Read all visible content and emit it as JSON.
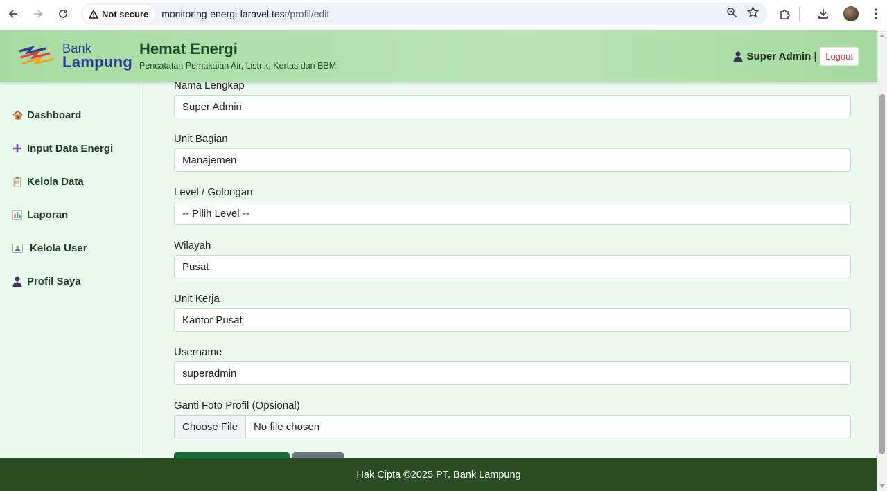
{
  "browser": {
    "security_label": "Not secure",
    "url_host": "monitoring-energi-laravel.test",
    "url_path": "/profil/edit"
  },
  "header": {
    "logo_bank": "Bank",
    "logo_lampung": "Lampung",
    "title": "Hemat Energi",
    "subtitle": "Pencatatan Pemakaian Air, Listrik, Kertas dan BBM",
    "user_name": "Super Admin",
    "separator": "|",
    "logout_label": "Logout"
  },
  "sidebar": {
    "items": [
      {
        "label": "Dashboard",
        "icon": "house-icon"
      },
      {
        "label": "Input Data Energi",
        "icon": "plus-icon"
      },
      {
        "label": "Kelola Data",
        "icon": "clipboard-icon"
      },
      {
        "label": "Laporan",
        "icon": "bar-chart-icon"
      },
      {
        "label": "Kelola User",
        "icon": "id-card-icon"
      },
      {
        "label": "Profil Saya",
        "icon": "user-icon"
      }
    ]
  },
  "form": {
    "nama_label": "Nama Lengkap",
    "nama_value": "Super Admin",
    "unit_bagian_label": "Unit Bagian",
    "unit_bagian_value": "Manajemen",
    "level_label": "Level / Golongan",
    "level_value": "-- Pilih Level --",
    "wilayah_label": "Wilayah",
    "wilayah_value": "Pusat",
    "unit_kerja_label": "Unit Kerja",
    "unit_kerja_value": "Kantor Pusat",
    "username_label": "Username",
    "username_value": "superadmin",
    "foto_label": "Ganti Foto Profil (Opsional)",
    "file_button": "Choose File",
    "file_status": "No file chosen"
  },
  "footer": {
    "text": "Hak Cipta ©2025 PT. Bank Lampung"
  },
  "colors": {
    "header_bg": "#b9e5b3",
    "sidebar_bg": "#e9f9ec",
    "content_bg": "#ecf9ef",
    "footer_bg": "#2b4d24",
    "brand_text": "#1d4e2b",
    "logout_text": "#dc3545",
    "save_button": "#1e6b3b",
    "cancel_button": "#6c757d"
  }
}
